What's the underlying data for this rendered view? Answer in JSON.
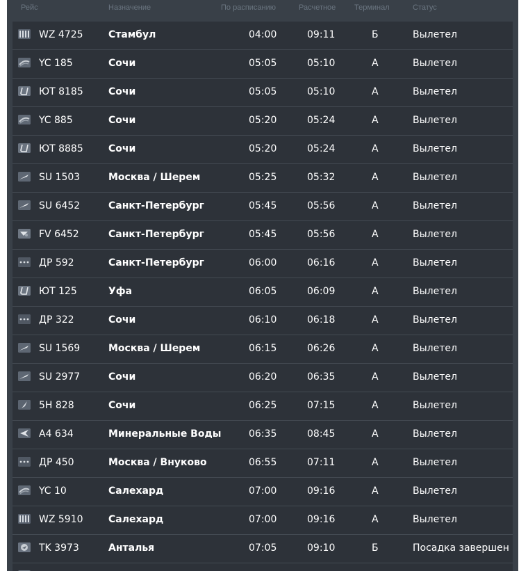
{
  "columns": {
    "flight": "Рейс",
    "destination": "Назначение",
    "scheduled": "По расписанию",
    "estimated": "Расчетное",
    "terminal": "Терминал",
    "status": "Статус"
  },
  "rows": [
    {
      "logo": "windrose-logo-icon",
      "flight": "WZ 4725",
      "destination": "Стамбул",
      "scheduled": "04:00",
      "estimated": "09:11",
      "terminal": "Б",
      "status": "Вылетел"
    },
    {
      "logo": "yamal-logo-icon",
      "flight": "YC 185",
      "destination": "Сочи",
      "scheduled": "05:05",
      "estimated": "05:10",
      "terminal": "А",
      "status": "Вылетел"
    },
    {
      "logo": "utair-logo-icon",
      "flight": "ЮТ 8185",
      "destination": "Сочи",
      "scheduled": "05:05",
      "estimated": "05:10",
      "terminal": "А",
      "status": "Вылетел"
    },
    {
      "logo": "yamal-logo-icon",
      "flight": "YC 885",
      "destination": "Сочи",
      "scheduled": "05:20",
      "estimated": "05:24",
      "terminal": "А",
      "status": "Вылетел"
    },
    {
      "logo": "utair-logo-icon",
      "flight": "ЮТ 8885",
      "destination": "Сочи",
      "scheduled": "05:20",
      "estimated": "05:24",
      "terminal": "А",
      "status": "Вылетел"
    },
    {
      "logo": "aeroflot-logo-icon",
      "flight": "SU 1503",
      "destination": "Москва / Шерем",
      "scheduled": "05:25",
      "estimated": "05:32",
      "terminal": "А",
      "status": "Вылетел"
    },
    {
      "logo": "aeroflot-logo-icon",
      "flight": "SU 6452",
      "destination": "Санкт-Петербург",
      "scheduled": "05:45",
      "estimated": "05:56",
      "terminal": "А",
      "status": "Вылетел"
    },
    {
      "logo": "rossiya-logo-icon",
      "flight": "FV 6452",
      "destination": "Санкт-Петербург",
      "scheduled": "05:45",
      "estimated": "05:56",
      "terminal": "А",
      "status": "Вылетел"
    },
    {
      "logo": "pobeda-logo-icon",
      "flight": "ДР 592",
      "destination": "Санкт-Петербург",
      "scheduled": "06:00",
      "estimated": "06:16",
      "terminal": "А",
      "status": "Вылетел"
    },
    {
      "logo": "utair-logo-icon",
      "flight": "ЮТ 125",
      "destination": "Уфа",
      "scheduled": "06:05",
      "estimated": "06:09",
      "terminal": "А",
      "status": "Вылетел"
    },
    {
      "logo": "pobeda-logo-icon",
      "flight": "ДР 322",
      "destination": "Сочи",
      "scheduled": "06:10",
      "estimated": "06:18",
      "terminal": "А",
      "status": "Вылетел"
    },
    {
      "logo": "aeroflot-logo-icon",
      "flight": "SU 1569",
      "destination": "Москва / Шерем",
      "scheduled": "06:15",
      "estimated": "06:26",
      "terminal": "А",
      "status": "Вылетел"
    },
    {
      "logo": "aeroflot-logo-icon",
      "flight": "SU 2977",
      "destination": "Сочи",
      "scheduled": "06:20",
      "estimated": "06:35",
      "terminal": "А",
      "status": "Вылетел"
    },
    {
      "logo": "nordwind-logo-icon",
      "flight": "5H 828",
      "destination": "Сочи",
      "scheduled": "06:25",
      "estimated": "07:15",
      "terminal": "А",
      "status": "Вылетел"
    },
    {
      "logo": "azimuth-logo-icon",
      "flight": "А4 634",
      "destination": "Минеральные Воды",
      "scheduled": "06:35",
      "estimated": "08:45",
      "terminal": "А",
      "status": "Вылетел"
    },
    {
      "logo": "pobeda-logo-icon",
      "flight": "ДР 450",
      "destination": "Москва / Внуково",
      "scheduled": "06:55",
      "estimated": "07:11",
      "terminal": "А",
      "status": "Вылетел"
    },
    {
      "logo": "yamal-logo-icon",
      "flight": "YC 10",
      "destination": "Салехард",
      "scheduled": "07:00",
      "estimated": "09:16",
      "terminal": "А",
      "status": "Вылетел"
    },
    {
      "logo": "windrose-logo-icon",
      "flight": "WZ 5910",
      "destination": "Салехард",
      "scheduled": "07:00",
      "estimated": "09:16",
      "terminal": "А",
      "status": "Вылетел"
    },
    {
      "logo": "turkish-logo-icon",
      "flight": "TK 3973",
      "destination": "Анталья",
      "scheduled": "07:05",
      "estimated": "09:10",
      "terminal": "Б",
      "status": "Посадка завершен"
    }
  ]
}
